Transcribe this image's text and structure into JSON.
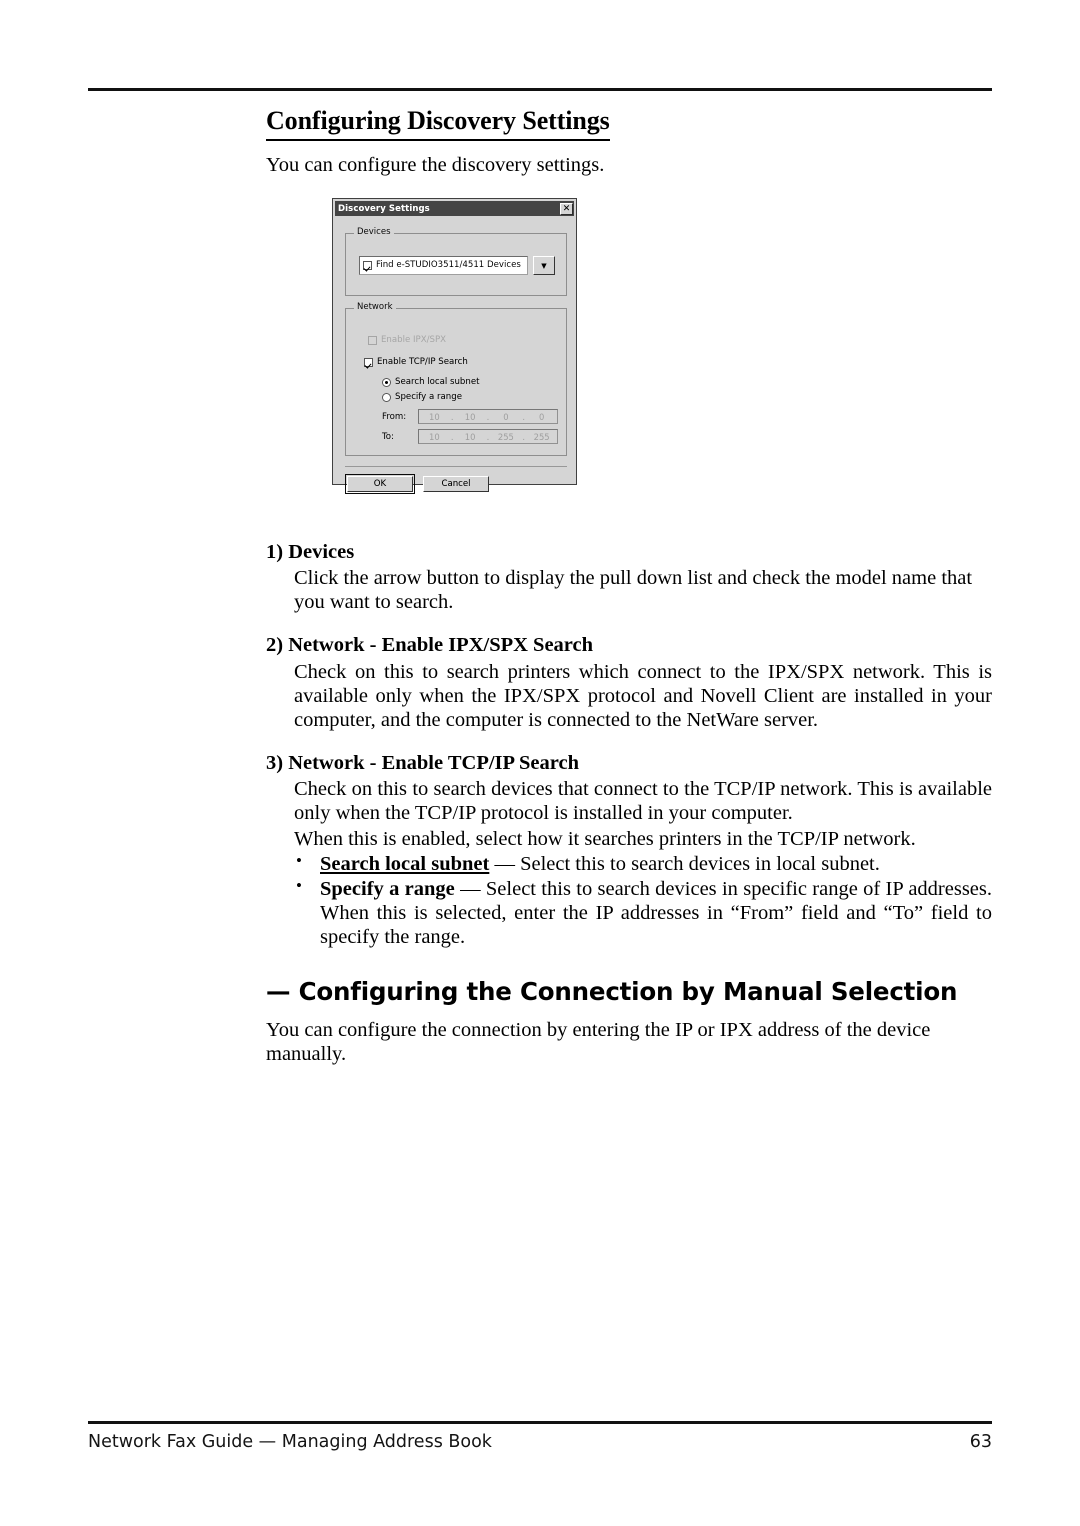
{
  "page": {
    "number": "63",
    "footer_text": "Network Fax Guide — Managing Address Book"
  },
  "section": {
    "title": "Configuring Discovery Settings",
    "intro": "You can configure the discovery settings."
  },
  "dialog": {
    "title": "Discovery Settings",
    "close_label": "✕",
    "groups": {
      "devices": {
        "legend": "Devices",
        "combo_checkbox_checked": true,
        "combo_value": "Find e-STUDIO3511/4511 Devices",
        "dropdown_arrow": "▼"
      },
      "network": {
        "legend": "Network",
        "ipx_label": "Enable IPX/SPX",
        "ipx_checked": false,
        "ipx_disabled": true,
        "tcpip_label": "Enable TCP/IP Search",
        "tcpip_checked": true,
        "radio_local_label": "Search local subnet",
        "radio_local_selected": true,
        "radio_range_label": "Specify a range",
        "radio_range_selected": false,
        "from_label": "From:",
        "from_octets": [
          "10",
          "10",
          "0",
          "0"
        ],
        "to_label": "To:",
        "to_octets": [
          "10",
          "10",
          "255",
          "255"
        ],
        "dot": "."
      }
    },
    "buttons": {
      "ok": "OK",
      "cancel": "Cancel"
    }
  },
  "items": [
    {
      "head": "1) Devices",
      "body": "Click the arrow button to display the pull down list and check the model name that you want to search."
    },
    {
      "head": "2) Network - Enable IPX/SPX Search",
      "body": "Check on this to search printers which connect to the IPX/SPX network.  This is available only when the IPX/SPX protocol and Novell Client are installed in your computer, and the computer is connected to the NetWare server."
    },
    {
      "head": "3) Network - Enable TCP/IP Search",
      "body": "Check on this to search devices that connect to the TCP/IP network.  This is available only when the TCP/IP protocol is installed in your computer.",
      "body2": "When this is enabled, select how it searches printers in the TCP/IP network.",
      "bullets": [
        {
          "term": "Search local subnet",
          "underline": true,
          "text": " — Select this to search devices in local subnet."
        },
        {
          "term": "Specify a range",
          "underline": false,
          "text": " — Select this to search devices in specific range of IP addresses.  When this is selected, enter the IP addresses in “From” field and “To” field to specify the range."
        }
      ]
    }
  ],
  "subsection": {
    "title": "— Configuring the Connection by Manual Selection",
    "body": "You can configure the connection by entering the IP or IPX address of the device manually."
  }
}
